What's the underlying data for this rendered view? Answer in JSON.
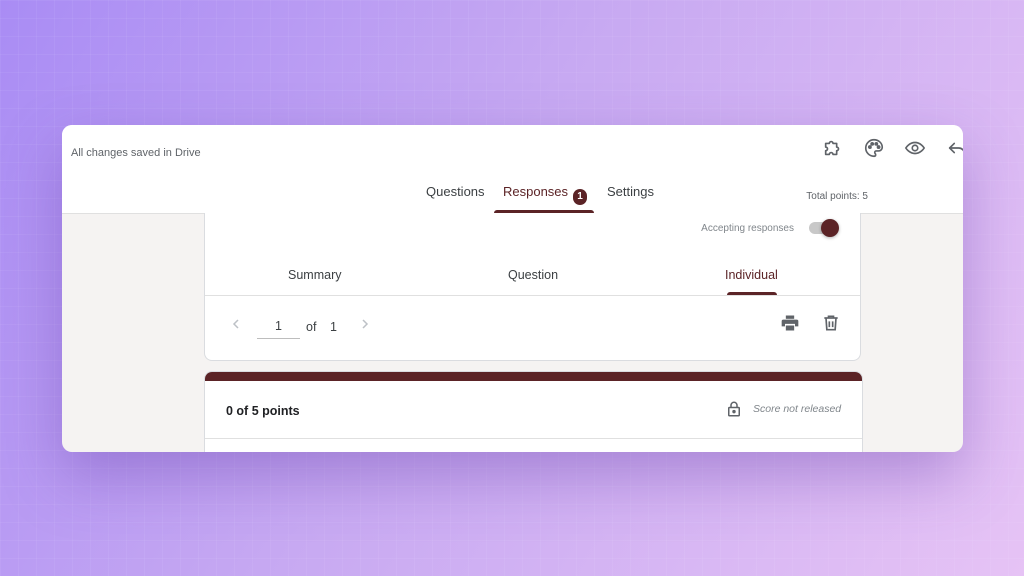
{
  "header": {
    "save_status": "All changes saved in Drive",
    "icons": [
      "puzzle-icon",
      "palette-icon",
      "eye-icon",
      "undo-icon"
    ]
  },
  "tabs": {
    "questions": "Questions",
    "responses": "Responses",
    "responses_badge": "1",
    "settings": "Settings",
    "total_points": "Total points: 5"
  },
  "responses_card": {
    "accepting_label": "Accepting responses",
    "accepting_on": true,
    "subtabs": {
      "summary": "Summary",
      "question": "Question",
      "individual": "Individual"
    },
    "pager": {
      "current": "1",
      "of_label": "of",
      "total": "1"
    }
  },
  "score_card": {
    "points": "0 of 5 points",
    "release_status": "Score not released"
  },
  "colors": {
    "accent": "#5b2326",
    "background_gradient_start": "#a98cf4",
    "background_gradient_end": "#e6c3f5"
  }
}
